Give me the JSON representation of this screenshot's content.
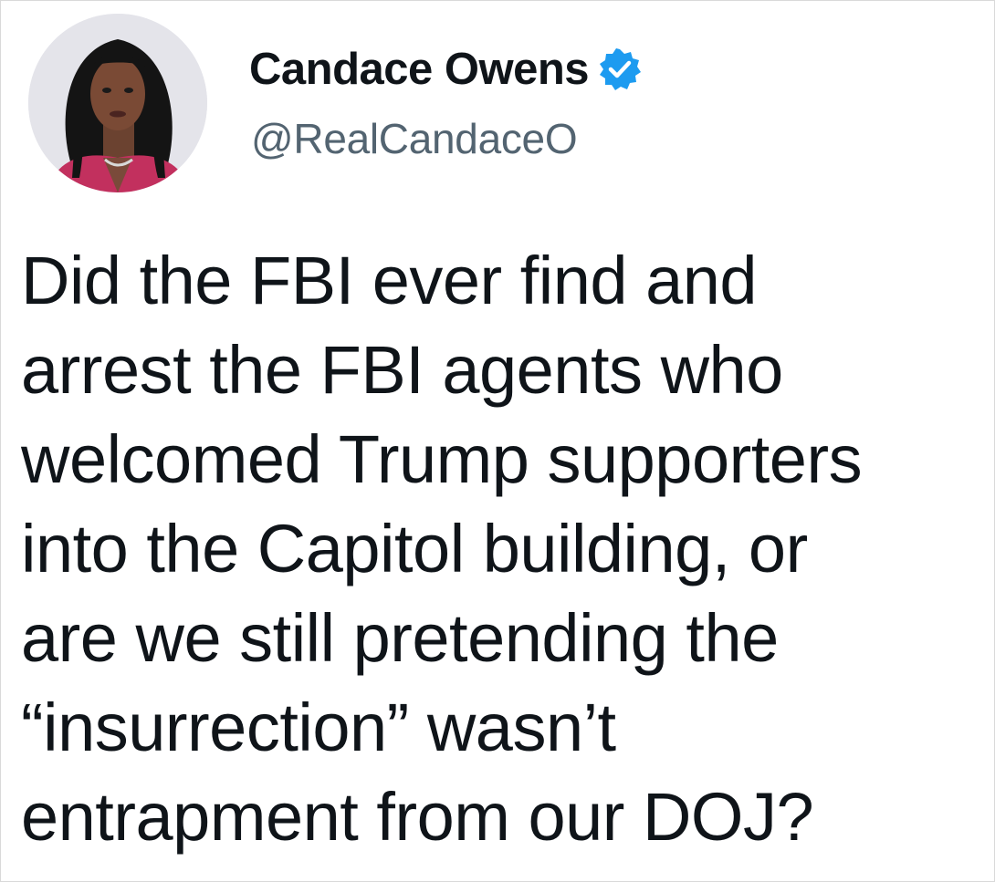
{
  "tweet": {
    "author": {
      "display_name": "Candace Owens",
      "handle": "@RealCandaceO",
      "verified": true,
      "avatar_icon": "profile-photo"
    },
    "text_lines": [
      "Did the FBI ever find and",
      "arrest the FBI agents who",
      "welcomed Trump supporters",
      "into the Capitol building, or",
      "are we still pretending the",
      "“insurrection” wasn’t",
      "entrapment from our DOJ?"
    ]
  },
  "colors": {
    "text": "#0f1419",
    "handle": "#536471",
    "verified_badge": "#1d9bf0"
  }
}
